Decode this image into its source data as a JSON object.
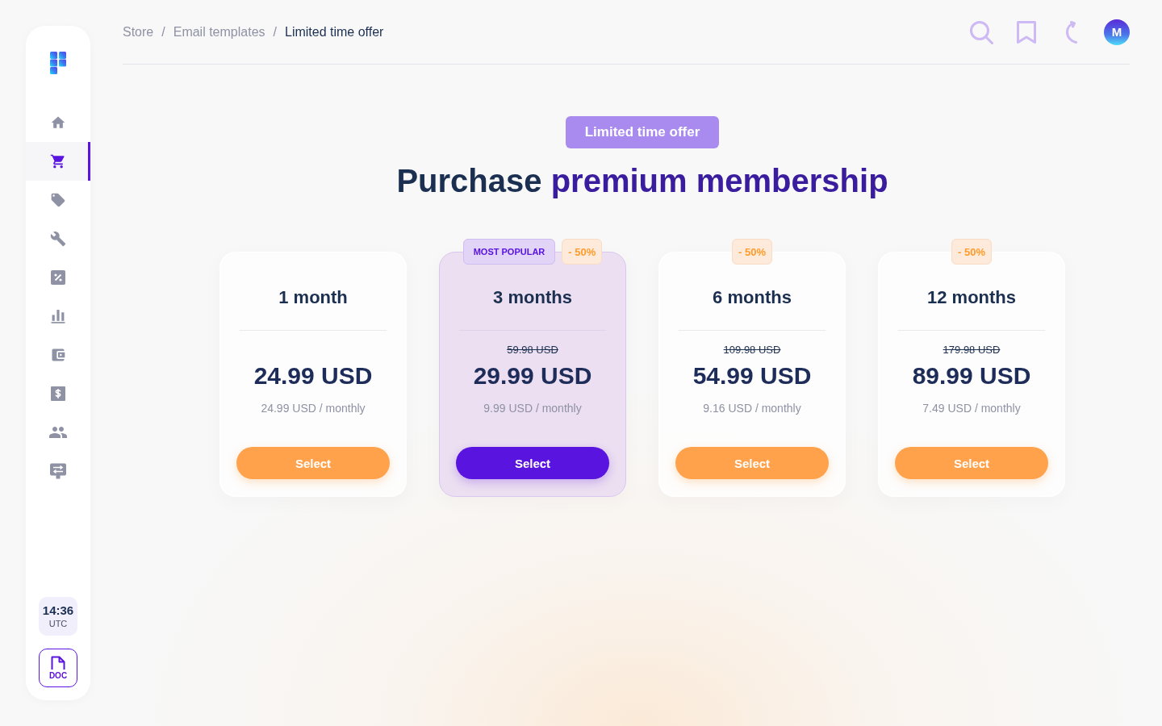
{
  "sidebar": {
    "nav_items": [
      {
        "selected": false
      },
      {
        "selected": true
      },
      {
        "selected": false
      },
      {
        "selected": false
      },
      {
        "selected": false
      },
      {
        "selected": false
      },
      {
        "selected": false
      },
      {
        "selected": false
      },
      {
        "selected": false
      },
      {
        "selected": false
      }
    ],
    "clock": {
      "time": "14:36",
      "zone": "UTC"
    },
    "doc_button": {
      "label": "DOC"
    }
  },
  "header": {
    "breadcrumb": {
      "items": [
        {
          "label": "Store",
          "current": false
        },
        {
          "label": "Email templates",
          "current": false
        },
        {
          "label": "Limited time offer",
          "current": true
        }
      ],
      "separators": [
        "/",
        "/"
      ]
    },
    "avatar": {
      "initial": "M"
    }
  },
  "offer": {
    "badge": "Limited time offer",
    "title": {
      "lead": "Purchase",
      "highlight": "premium membership"
    }
  },
  "plans": [
    {
      "name": "1 month",
      "price": "24.99 USD",
      "per_month": "24.99 USD / monthly",
      "button": "Select",
      "featured": false
    },
    {
      "name": "3 months",
      "old_price": "59.98 USD",
      "price": "29.99 USD",
      "per_month": "9.99 USD / monthly",
      "button": "Select",
      "featured": true,
      "badges": [
        {
          "kind": "popular",
          "label": "MOST POPULAR"
        },
        {
          "kind": "discount",
          "label": "- 50%"
        }
      ]
    },
    {
      "name": "6 months",
      "old_price": "109.98 USD",
      "price": "54.99 USD",
      "per_month": "9.16 USD / monthly",
      "button": "Select",
      "featured": false,
      "badges": [
        {
          "kind": "discount",
          "label": "- 50%"
        }
      ]
    },
    {
      "name": "12 months",
      "old_price": "179.98 USD",
      "price": "89.99 USD",
      "per_month": "7.49 USD / monthly",
      "button": "Select",
      "featured": false,
      "badges": [
        {
          "kind": "discount",
          "label": "- 50%"
        }
      ]
    }
  ]
}
